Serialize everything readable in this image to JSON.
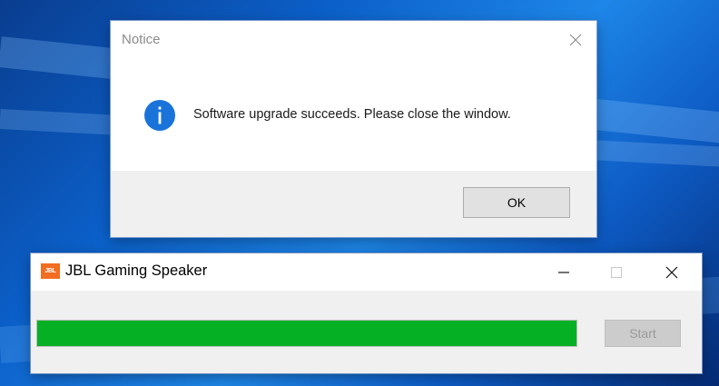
{
  "notice_dialog": {
    "title": "Notice",
    "message": "Software upgrade succeeds. Please close the window.",
    "ok_label": "OK",
    "icon": "info-icon",
    "close_icon": "close-icon"
  },
  "app_window": {
    "logo_text": "JBL",
    "title": "JBL Gaming Speaker",
    "progress_fraction": 1.0,
    "progress_color": "#06b025",
    "start_label": "Start",
    "start_enabled": false,
    "window_controls": [
      "minimize-icon",
      "maximize-icon",
      "close-icon"
    ]
  },
  "colors": {
    "info_icon": "#1a73d9",
    "start_button_disabled": "#cccccc"
  }
}
